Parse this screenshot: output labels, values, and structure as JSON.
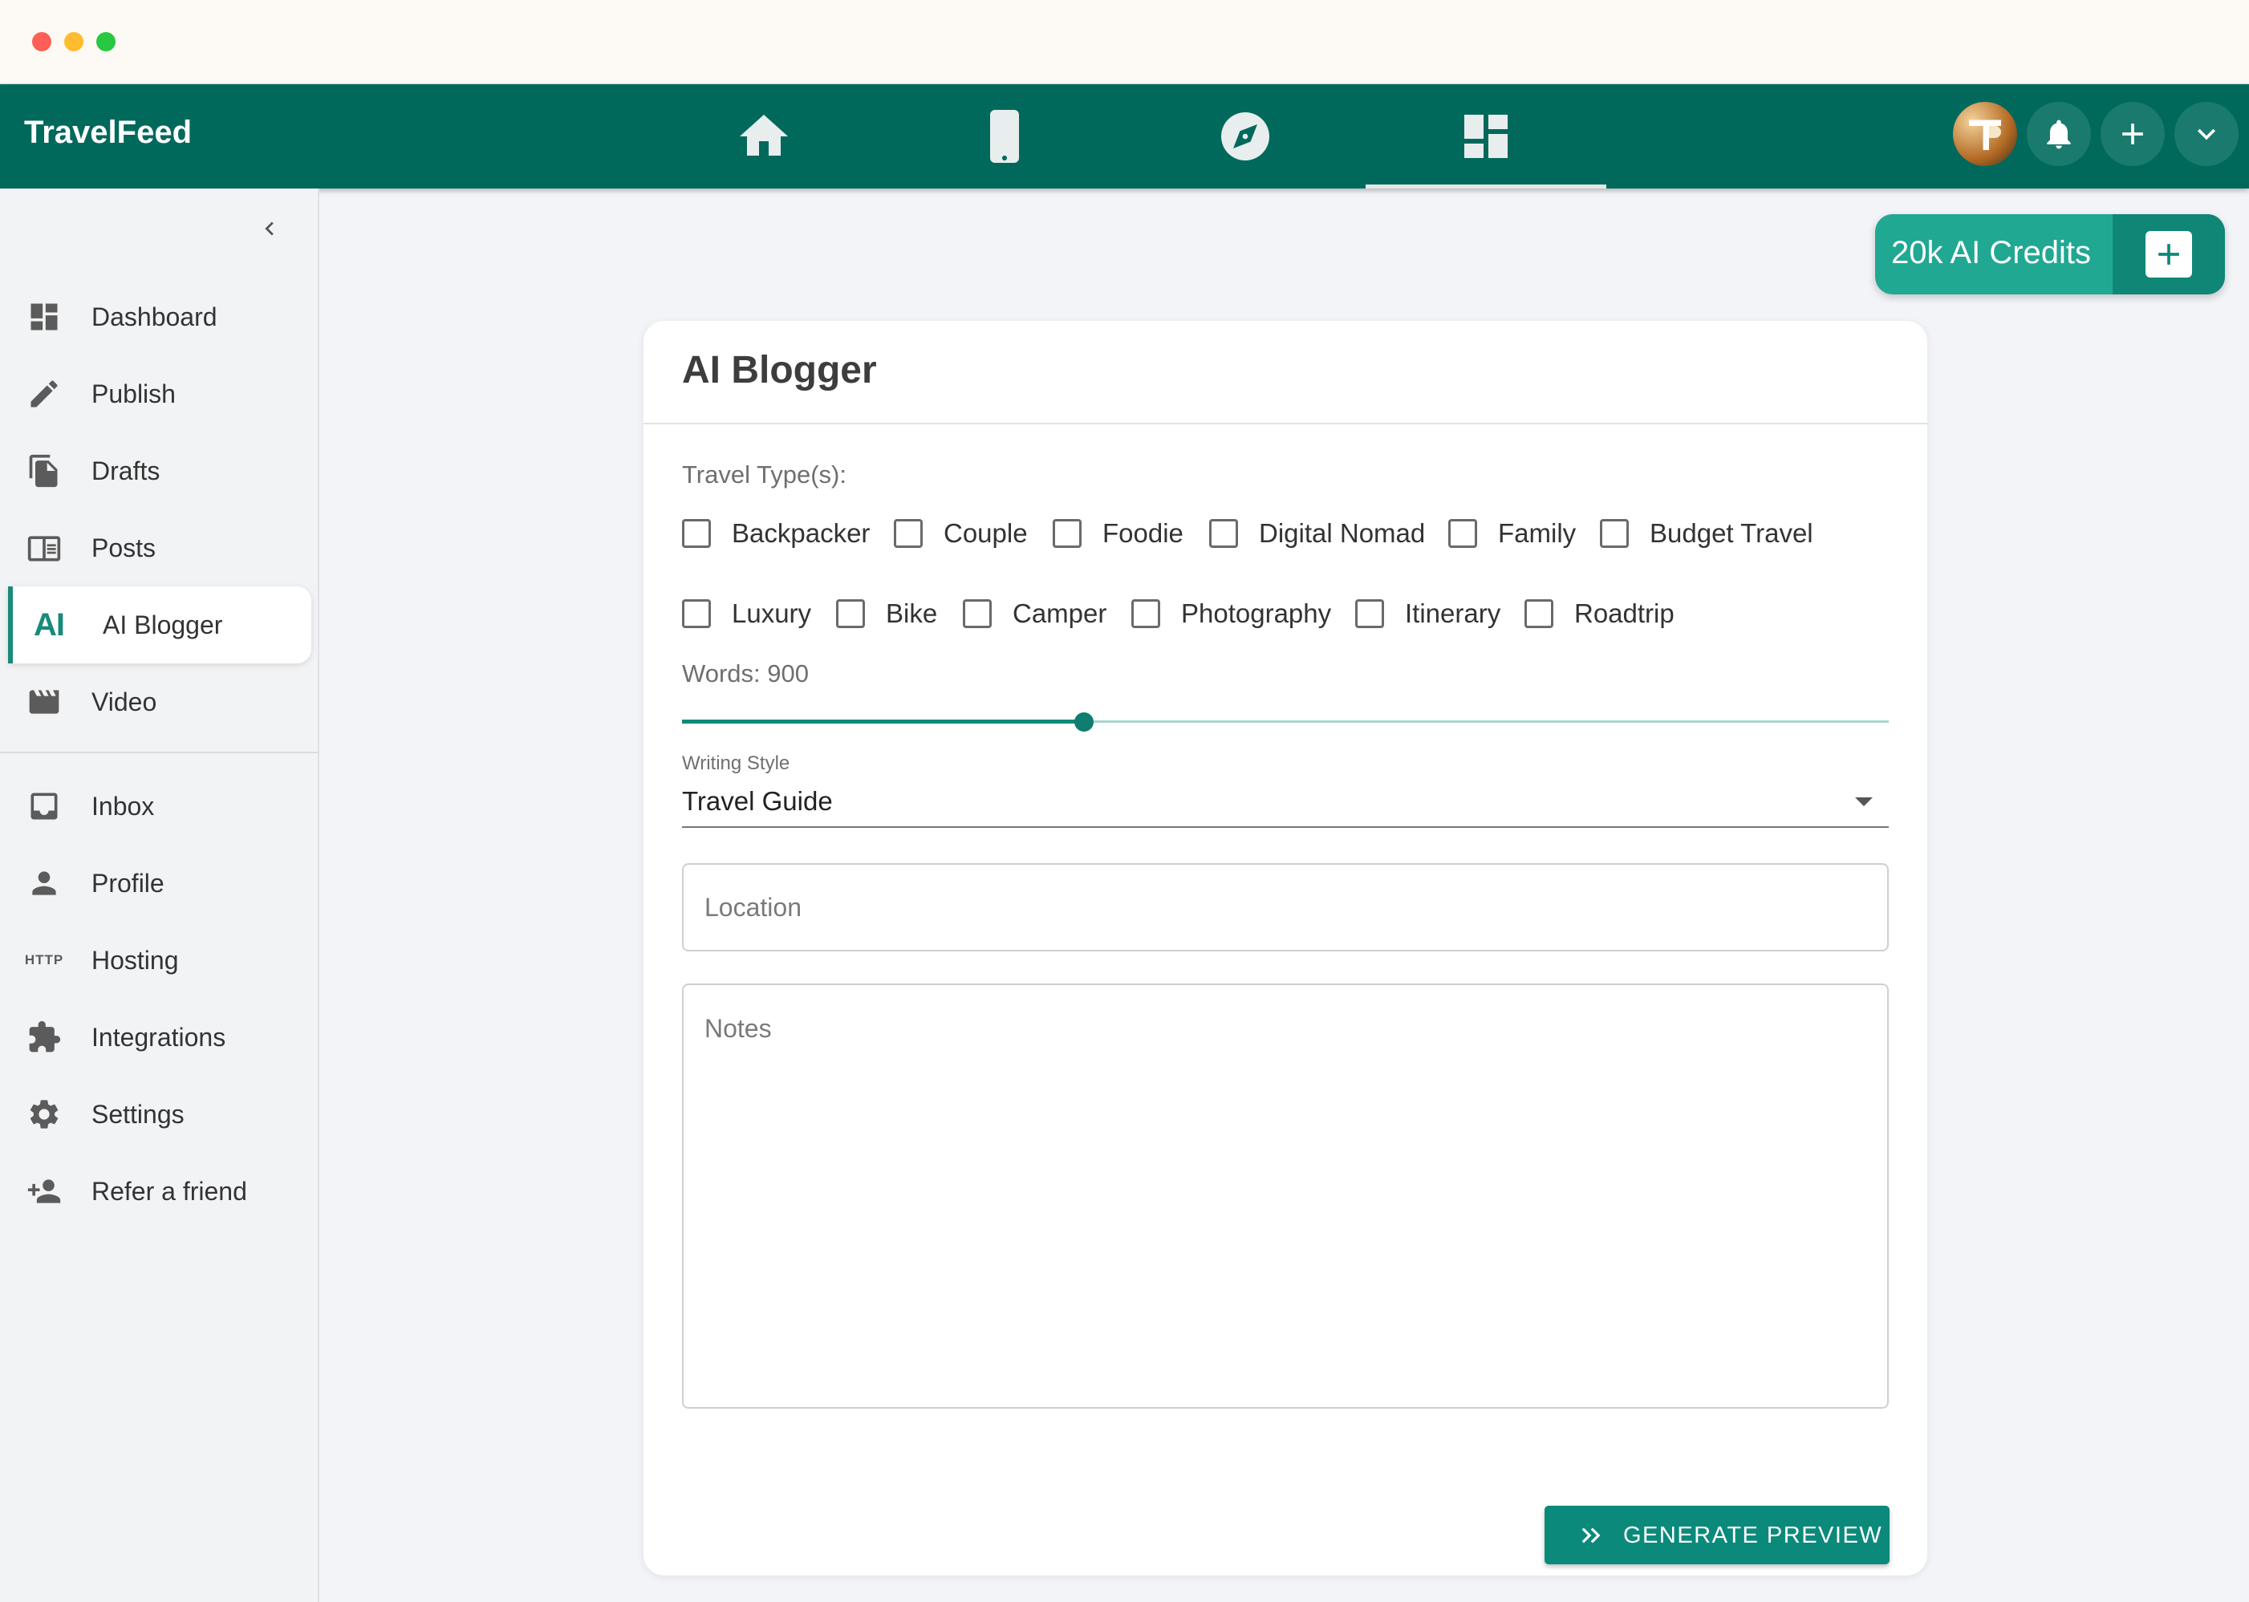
{
  "app": {
    "brand": "TravelFeed"
  },
  "topnav": {
    "tabs": [
      {
        "name": "home",
        "icon": "home-icon"
      },
      {
        "name": "mobile",
        "icon": "phone-icon"
      },
      {
        "name": "explore",
        "icon": "compass-icon"
      },
      {
        "name": "dashboard",
        "icon": "dashboard-icon",
        "active": true
      }
    ],
    "right_icons": [
      "avatar",
      "bell-icon",
      "plus-icon",
      "chevron-down-icon"
    ]
  },
  "sidebar": {
    "items": [
      {
        "label": "Dashboard",
        "icon": "dashboard-icon"
      },
      {
        "label": "Publish",
        "icon": "pencil-icon"
      },
      {
        "label": "Drafts",
        "icon": "documents-icon"
      },
      {
        "label": "Posts",
        "icon": "feed-icon"
      },
      {
        "label": "AI Blogger",
        "icon": "ai-icon",
        "icon_text": "AI",
        "active": true
      },
      {
        "label": "Video",
        "icon": "clapperboard-icon"
      },
      {
        "label": "Inbox",
        "icon": "inbox-icon"
      },
      {
        "label": "Profile",
        "icon": "person-icon"
      },
      {
        "label": "Hosting",
        "icon": "http-icon",
        "icon_text": "HTTP"
      },
      {
        "label": "Integrations",
        "icon": "puzzle-icon"
      },
      {
        "label": "Settings",
        "icon": "gear-icon"
      },
      {
        "label": "Refer a friend",
        "icon": "person-add-icon"
      }
    ]
  },
  "credits": {
    "label": "20k AI Credits"
  },
  "card": {
    "title": "AI Blogger",
    "travel_types_label": "Travel Type(s):",
    "travel_types_row1": [
      "Backpacker",
      "Couple",
      "Foodie",
      "Digital Nomad",
      "Family",
      "Budget Travel"
    ],
    "travel_types_row2": [
      "Luxury",
      "Bike",
      "Camper",
      "Photography",
      "Itinerary",
      "Roadtrip"
    ],
    "words_label": "Words: 900",
    "words_fraction": 0.333,
    "writing_style_label": "Writing Style",
    "writing_style_value": "Travel Guide",
    "location_placeholder": "Location",
    "notes_placeholder": "Notes",
    "generate_label": "GENERATE PREVIEW"
  },
  "colors": {
    "primary": "#01695c",
    "accent": "#1a8a7b",
    "credits_bg": "#20a893"
  }
}
